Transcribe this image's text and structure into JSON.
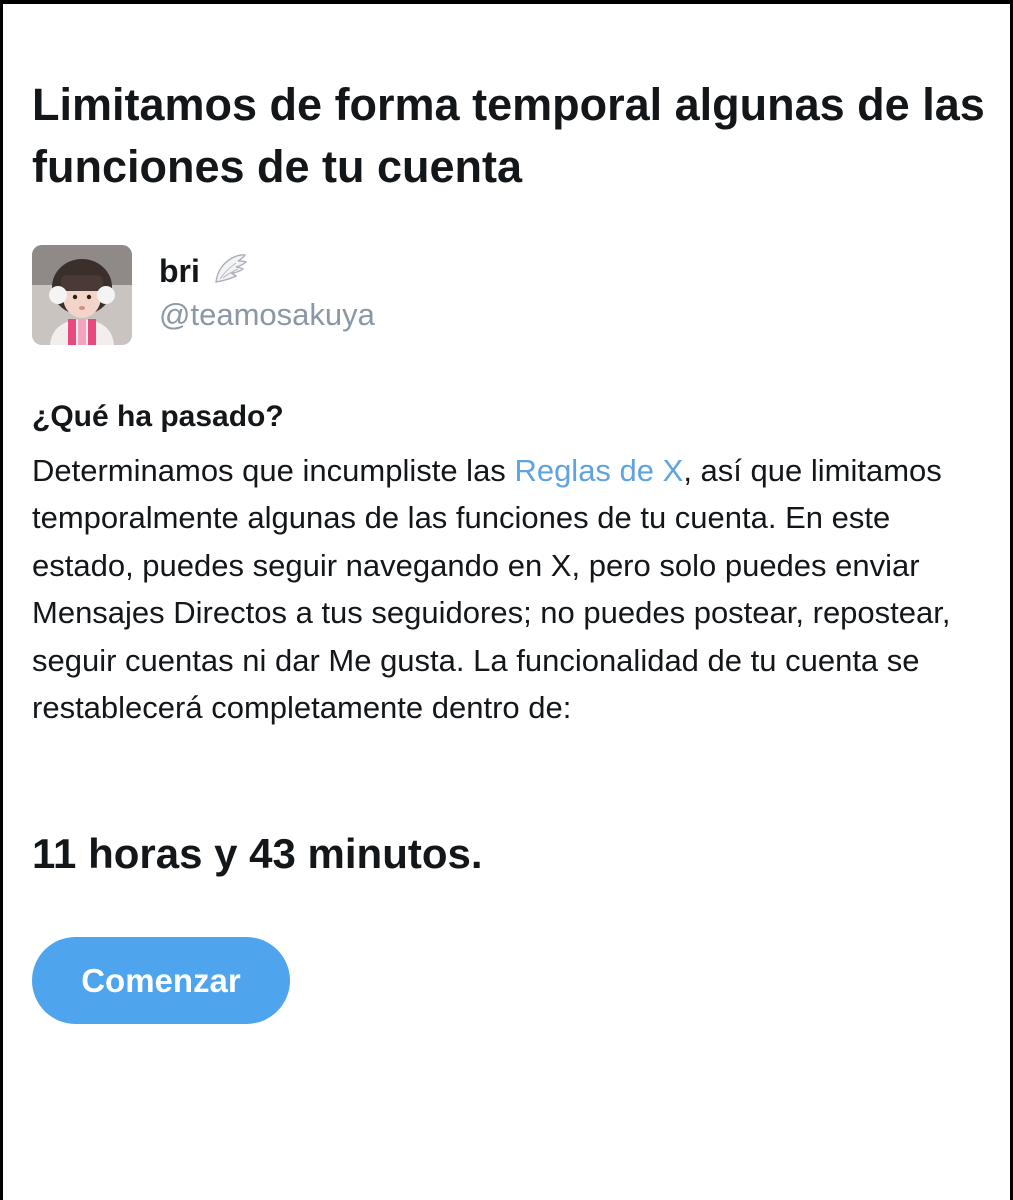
{
  "header": {
    "title": "Limitamos de forma temporal algunas de las funciones de tu cuenta"
  },
  "profile": {
    "display_name": "bri",
    "name_emoji_icon": "angel-wing-icon",
    "handle": "@teamosakuya"
  },
  "section": {
    "heading": "¿Qué ha pasado?",
    "body_before_link": "Determinamos que incumpliste las ",
    "link_text": "Reglas de X",
    "body_after_link": ", así que limitamos temporalmente algunas de las funciones de tu cuenta. En este estado, puedes seguir navegando en X, pero solo puedes enviar Mensajes Directos a tus seguidores; no puedes postear, repostear, seguir cuentas ni dar Me gusta. La funcionalidad de tu cuenta se restablecerá completamente dentro de:"
  },
  "countdown": {
    "text": "11 horas y 43 minutos."
  },
  "actions": {
    "start_label": "Comenzar"
  },
  "colors": {
    "link": "#5fa3e0",
    "button": "#4ea4ed",
    "handle": "#8a98a5",
    "text": "#14171a"
  }
}
